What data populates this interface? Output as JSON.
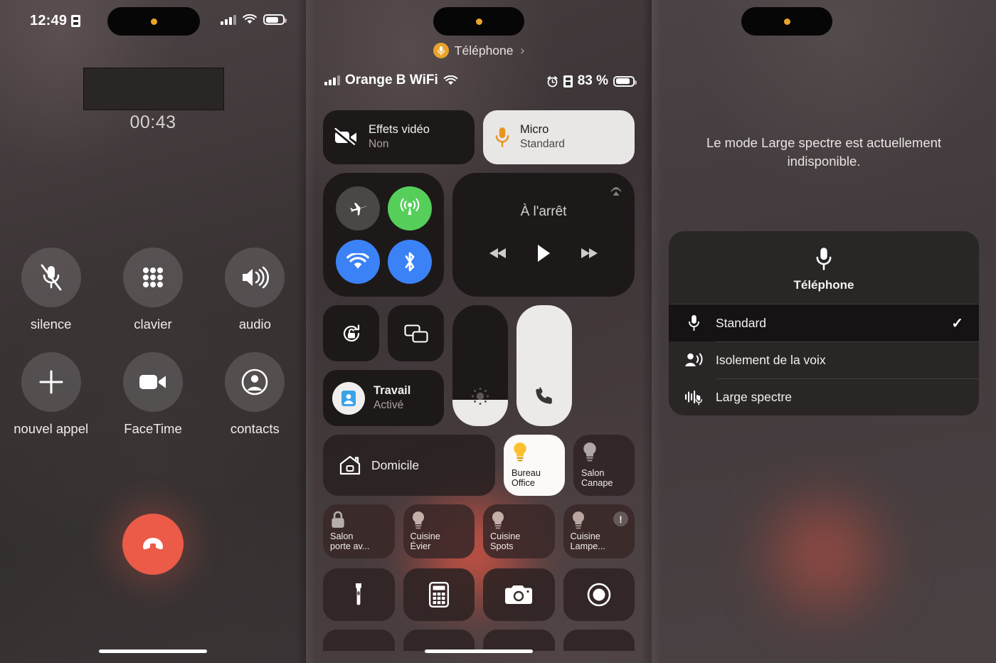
{
  "panel1": {
    "status_bar": {
      "time": "12:49",
      "record_icon": "id-card-icon",
      "signal_icon": "cellular-bars-icon",
      "wifi_icon": "wifi-icon",
      "battery_icon": "battery-icon"
    },
    "contact_card_redacted": "",
    "call_timer": "00:43",
    "buttons": [
      {
        "label": "silence",
        "icon": "mic-slash-icon"
      },
      {
        "label": "clavier",
        "icon": "keypad-icon"
      },
      {
        "label": "audio",
        "icon": "speaker-wave-icon"
      },
      {
        "label": "nouvel appel",
        "icon": "plus-icon"
      },
      {
        "label": "FaceTime",
        "icon": "video-camera-icon"
      },
      {
        "label": "contacts",
        "icon": "person-circle-icon"
      }
    ],
    "end_call": {
      "name": "end-call-button",
      "icon": "phone-down-icon",
      "color": "#ec5a48"
    },
    "home_indicator": ""
  },
  "panel2": {
    "header": {
      "badge_icon": "mic-icon",
      "label": "Téléphone",
      "chevron": "›"
    },
    "status_bar": {
      "carrier": "Orange B WiFi",
      "wifi_icon": "wifi-icon",
      "alarm_icon": "alarm-clock-icon",
      "record_icon": "id-card-icon",
      "battery_text": "83 %",
      "battery_icon": "battery-icon"
    },
    "video_effects": {
      "title": "Effets vidéo",
      "value": "Non",
      "icon": "video-slash-icon"
    },
    "mic_mode": {
      "title": "Micro",
      "value": "Standard",
      "icon": "mic-icon",
      "active": true
    },
    "connectivity": [
      {
        "name": "airplane-mode",
        "icon": "airplane-icon",
        "state": "off"
      },
      {
        "name": "cellular-data",
        "icon": "antenna-radiowaves-icon",
        "state": "on-green"
      },
      {
        "name": "wifi",
        "icon": "wifi-icon",
        "state": "on-blue"
      },
      {
        "name": "bluetooth",
        "icon": "bluetooth-icon",
        "state": "on-blue"
      }
    ],
    "media": {
      "title": "À l'arrêt",
      "airplay_icon": "airplay-audio-icon",
      "prev_icon": "backward-icon",
      "play_icon": "play-icon",
      "next_icon": "forward-icon"
    },
    "rotation_lock": {
      "icon": "rotation-lock-icon"
    },
    "screen_mirroring": {
      "icon": "screen-mirroring-icon"
    },
    "focus": {
      "title": "Travail",
      "value": "Activé",
      "icon": "briefcase-badge-icon"
    },
    "brightness": {
      "icon": "brightness-icon",
      "level_percent": 22
    },
    "volume": {
      "icon": "phone-handset-icon",
      "level_percent": 100
    },
    "home_controls": {
      "home_label": "Domicile",
      "home_icon": "house-icon",
      "lights": [
        {
          "label_line1": "Bureau",
          "label_line2": "Office",
          "icon": "lightbulb-icon",
          "on": true
        },
        {
          "label_line1": "Salon",
          "label_line2": "Canape",
          "icon": "lightbulb-icon",
          "on": false
        }
      ],
      "accessories": [
        {
          "label_line1": "Salon",
          "label_line2": "porte av...",
          "icon": "lock-icon",
          "warning": false
        },
        {
          "label_line1": "Cuisine",
          "label_line2": "Évier",
          "icon": "lightbulb-icon",
          "warning": false
        },
        {
          "label_line1": "Cuisine",
          "label_line2": "Spots",
          "icon": "lightbulb-icon",
          "warning": false
        },
        {
          "label_line1": "Cuisine",
          "label_line2": "Lampe...",
          "icon": "lightbulb-icon",
          "warning": true,
          "warning_glyph": "!"
        }
      ]
    },
    "utilities": [
      {
        "name": "flashlight",
        "icon": "flashlight-icon"
      },
      {
        "name": "calculator",
        "icon": "calculator-icon"
      },
      {
        "name": "camera",
        "icon": "camera-icon"
      },
      {
        "name": "screen-record",
        "icon": "record-circle-icon"
      }
    ],
    "home_indicator": ""
  },
  "panel3": {
    "message": "Le mode Large spectre est actuellement indisponible.",
    "menu": {
      "header_icon": "mic-icon",
      "header_label": "Téléphone",
      "items": [
        {
          "label": "Standard",
          "icon": "mic-icon",
          "selected": true,
          "check": "✓"
        },
        {
          "label": "Isolement de la voix",
          "icon": "voice-isolation-icon",
          "selected": false,
          "check": ""
        },
        {
          "label": "Large spectre",
          "icon": "wide-spectrum-icon",
          "selected": false,
          "check": ""
        }
      ]
    }
  }
}
